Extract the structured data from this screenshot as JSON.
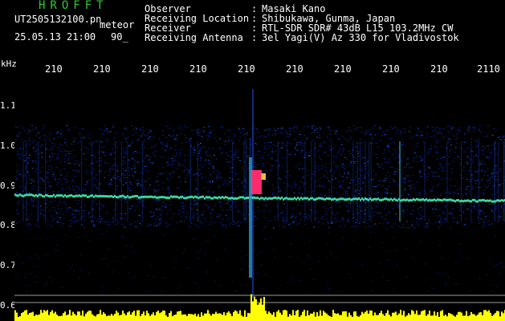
{
  "header": {
    "app_title": "HROFFT",
    "file_name": "UT2505132100.pn",
    "file_tag": "meteor",
    "date_time": "25.05.13 21:00",
    "minutes": "90_",
    "info_rows": [
      {
        "label": "Observer",
        "value": "Masaki Kano"
      },
      {
        "label": "Receiving Location",
        "value": "Shibukawa, Gunma, Japan"
      },
      {
        "label": "Receiver",
        "value": "RTL-SDR SDR# 43dB L15 103.2MHz CW"
      },
      {
        "label": "Receiving Antenna",
        "value": "3el Yagi(V) Az 330 for Vladivostok"
      }
    ]
  },
  "spectrogram": {
    "y_unit": "kHz",
    "y_ticks": [
      "1.1",
      "1.0",
      "0.9",
      "0.8",
      "0.7",
      "0.6"
    ],
    "x_ticks": [
      "210",
      "210",
      "210",
      "210",
      "210",
      "210",
      "210",
      "210",
      "210",
      "2110"
    ],
    "colors": {
      "background": "#000000",
      "noise": "#0a1f8a",
      "carrier": "#3ad6a0",
      "echo": "#ff2a6a",
      "signal_level": "#ffff00",
      "text": "#ffffff",
      "title": "#2ecc2e"
    }
  }
}
